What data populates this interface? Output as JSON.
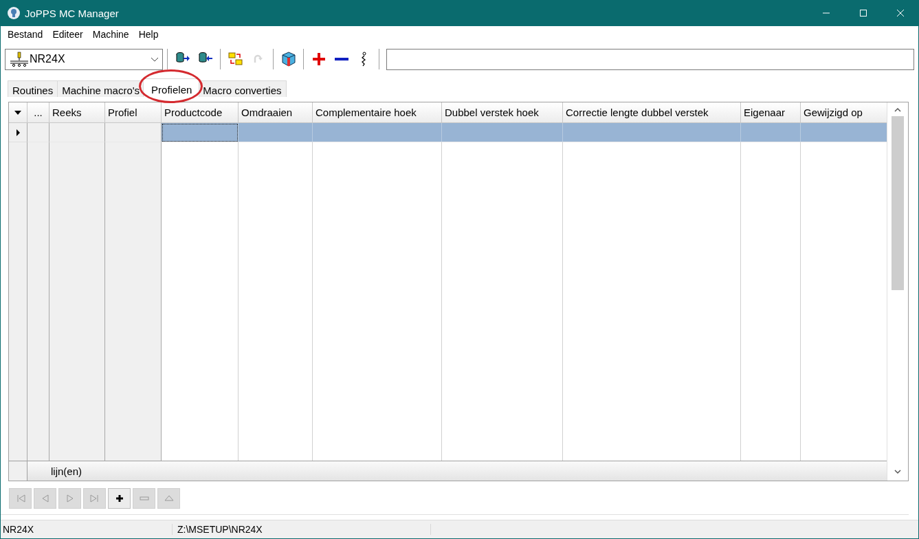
{
  "window": {
    "title": "JoPPS MC Manager"
  },
  "menu": [
    "Bestand",
    "Editeer",
    "Machine",
    "Help"
  ],
  "toolbar": {
    "machine": "NR24X",
    "items": [
      {
        "kind": "separator"
      },
      {
        "kind": "export",
        "disabled": false
      },
      {
        "kind": "import",
        "disabled": false
      },
      {
        "kind": "separator"
      },
      {
        "kind": "swap",
        "disabled": false
      },
      {
        "kind": "redo",
        "disabled": true
      },
      {
        "kind": "separator"
      },
      {
        "kind": "package",
        "disabled": false
      },
      {
        "kind": "separator"
      },
      {
        "kind": "add",
        "disabled": false
      },
      {
        "kind": "remove",
        "disabled": false
      },
      {
        "kind": "info",
        "disabled": false
      },
      {
        "kind": "separator"
      }
    ]
  },
  "tabs": [
    {
      "label": "Routines",
      "selected": false,
      "circled": false
    },
    {
      "label": "Machine macro's",
      "selected": false,
      "circled": false
    },
    {
      "label": "Profielen",
      "selected": true,
      "circled": true
    },
    {
      "label": "Macro converties",
      "selected": false,
      "circled": false
    }
  ],
  "table": {
    "columns": [
      {
        "label": "...",
        "fixed": true
      },
      {
        "label": "Reeks",
        "fixed": true
      },
      {
        "label": "Profiel",
        "fixed": true
      },
      {
        "label": "Productcode",
        "fixed": false
      },
      {
        "label": "Omdraaien",
        "fixed": false
      },
      {
        "label": "Complementaire hoek",
        "fixed": false
      },
      {
        "label": "Dubbel verstek hoek",
        "fixed": false
      },
      {
        "label": "Correctie lengte dubbel verstek",
        "fixed": false
      },
      {
        "label": "Eigenaar",
        "fixed": false
      },
      {
        "label": "Gewijzigd op",
        "fixed": false
      }
    ],
    "rows": [
      {
        "selected": true,
        "cells": [
          {
            "focused": false
          },
          {
            "focused": false
          },
          {
            "focused": false
          },
          {
            "focused": true
          },
          {
            "focused": false
          },
          {
            "focused": false
          },
          {
            "focused": false
          },
          {
            "focused": false
          },
          {
            "focused": false
          },
          {
            "focused": false
          }
        ]
      }
    ],
    "footer": "lijn(en)"
  },
  "navigator": [
    {
      "kind": "first",
      "disabled": true
    },
    {
      "kind": "prev",
      "disabled": true
    },
    {
      "kind": "next",
      "disabled": true
    },
    {
      "kind": "last",
      "disabled": true
    },
    {
      "kind": "add",
      "disabled": false
    },
    {
      "kind": "delete",
      "disabled": true
    },
    {
      "kind": "post",
      "disabled": true
    }
  ],
  "status_bar": [
    "NR24X",
    "Z:\\MSETUP\\NR24X"
  ]
}
